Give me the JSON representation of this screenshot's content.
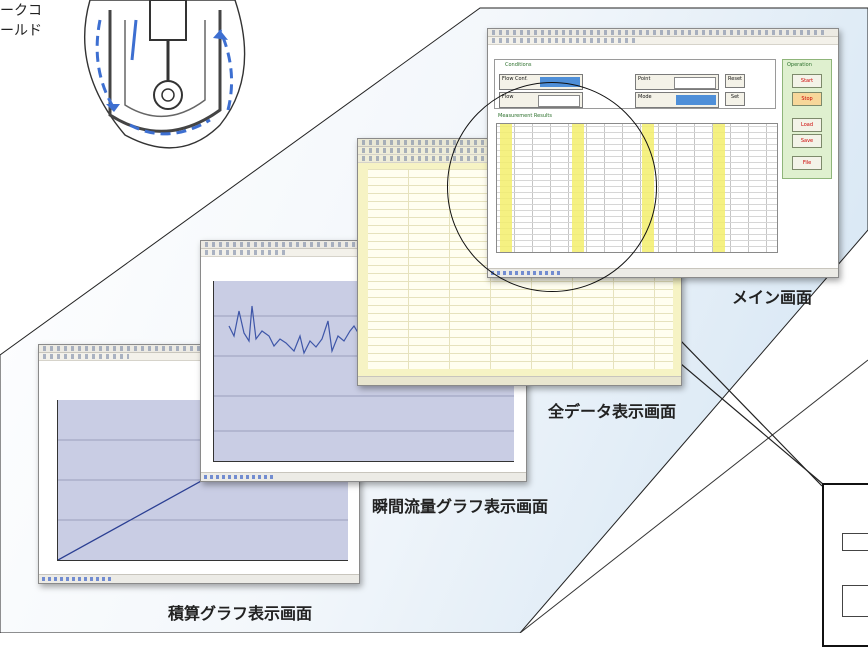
{
  "engine_labels": [
    "ークコ",
    "ールド"
  ],
  "captions": {
    "main": "メイン画面",
    "all_data": "全データ表示画面",
    "instant": "瞬間流量グラフ表示画面",
    "cumulative": "積算グラフ表示画面"
  },
  "main_window": {
    "conditions_title": "Conditions",
    "results_title": "Measurement Results",
    "operation_title": "Operation",
    "op_buttons": [
      "Start",
      "Stop",
      "Load",
      "Save",
      "File"
    ],
    "small_buttons": [
      "Reset",
      "Set"
    ],
    "fields": [
      "Flow Conf.",
      "Point",
      "Flow",
      "Mode",
      "Result"
    ]
  },
  "colors": {
    "highlight_yellow": "#f3ef6c",
    "graph_bg": "#c9cde4",
    "line": "#3e56a8",
    "field_blue": "#4f8fd8",
    "operation_green": "#dff0cf"
  }
}
